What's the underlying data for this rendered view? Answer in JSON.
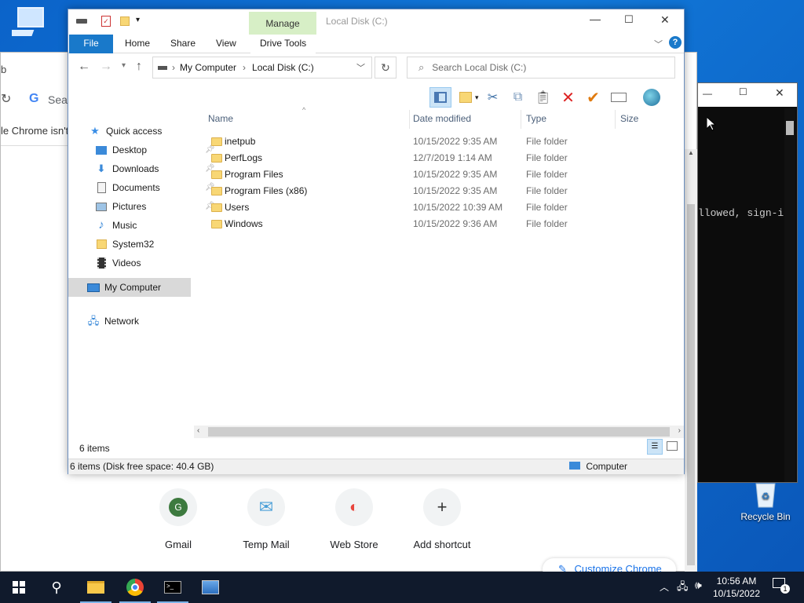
{
  "desktop": {
    "icons": [
      {
        "label": "My Computer"
      },
      {
        "label": "Recycle Bin"
      }
    ]
  },
  "chrome_bg": {
    "partial_left_text": "b",
    "address_placeholder_partial": "Sear",
    "notice_partial": "le Chrome isn't",
    "shortcuts": [
      {
        "label": "Gmail",
        "icon": "G"
      },
      {
        "label": "Temp Mail",
        "icon": "✉"
      },
      {
        "label": "Web Store",
        "icon": "◐"
      },
      {
        "label": "Add shortcut",
        "icon": "+"
      }
    ],
    "customize": "Customize Chrome"
  },
  "console_bg": {
    "text_partial": "llowed, sign-i"
  },
  "explorer": {
    "title": "Local Disk (C:)",
    "manage_label": "Manage",
    "tabs": [
      "File",
      "Home",
      "Share",
      "View",
      "Drive Tools"
    ],
    "breadcrumb": [
      "My Computer",
      "Local Disk (C:)"
    ],
    "search_placeholder": "Search Local Disk (C:)",
    "nav": {
      "quick_access": "Quick access",
      "items": [
        {
          "label": "Desktop",
          "icon": "desktop-icon",
          "pinned": true
        },
        {
          "label": "Downloads",
          "icon": "downloads-icon",
          "pinned": true
        },
        {
          "label": "Documents",
          "icon": "documents-icon",
          "pinned": true
        },
        {
          "label": "Pictures",
          "icon": "pictures-icon",
          "pinned": true
        },
        {
          "label": "Music",
          "icon": "music-icon",
          "pinned": false
        },
        {
          "label": "System32",
          "icon": "folder-icon",
          "pinned": false
        },
        {
          "label": "Videos",
          "icon": "videos-icon",
          "pinned": false
        }
      ],
      "my_computer": "My Computer",
      "network": "Network"
    },
    "columns": [
      "Name",
      "Date modified",
      "Type",
      "Size"
    ],
    "rows": [
      {
        "name": "inetpub",
        "date": "10/15/2022 9:35 AM",
        "type": "File folder"
      },
      {
        "name": "PerfLogs",
        "date": "12/7/2019 1:14 AM",
        "type": "File folder"
      },
      {
        "name": "Program Files",
        "date": "10/15/2022 9:35 AM",
        "type": "File folder"
      },
      {
        "name": "Program Files (x86)",
        "date": "10/15/2022 9:35 AM",
        "type": "File folder"
      },
      {
        "name": "Users",
        "date": "10/15/2022 10:39 AM",
        "type": "File folder"
      },
      {
        "name": "Windows",
        "date": "10/15/2022 9:36 AM",
        "type": "File folder"
      }
    ],
    "item_count": "6 items",
    "status_detail": "6 items (Disk free space: 40.4 GB)",
    "status_location": "Computer"
  },
  "taskbar": {
    "time": "10:56 AM",
    "date": "10/15/2022",
    "notification_count": "1"
  }
}
